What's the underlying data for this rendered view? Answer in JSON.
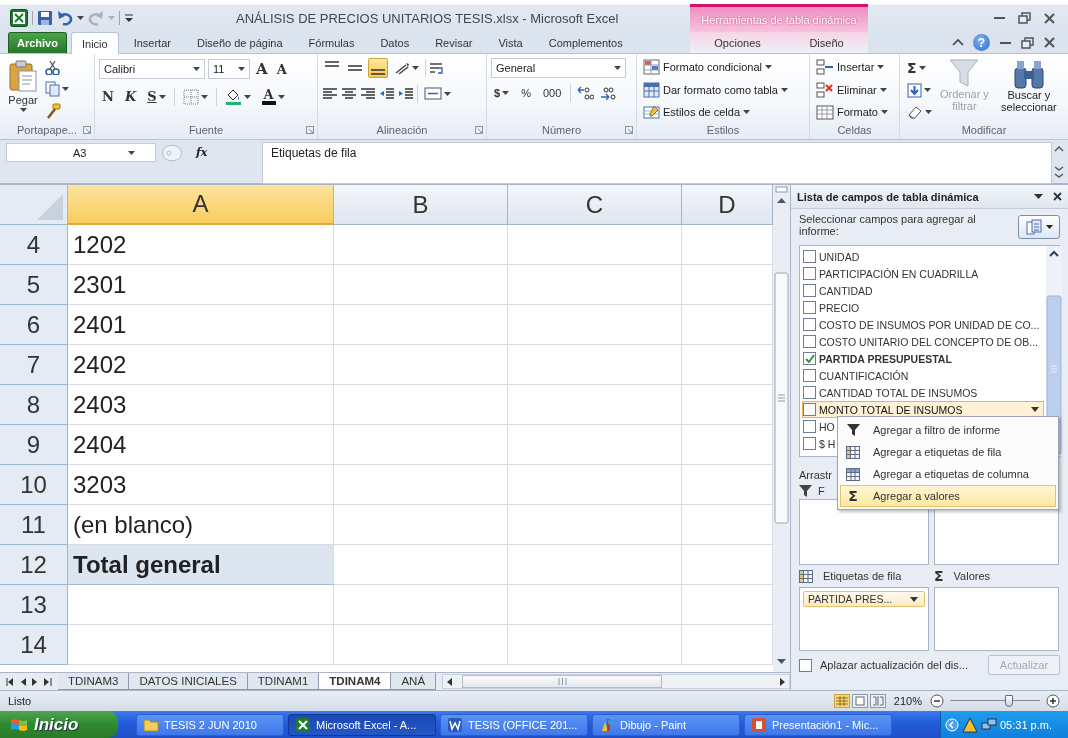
{
  "title_bar": {
    "title": "ANÁLISIS DE PRECIOS UNITARIOS TESIS.xlsx  -  Microsoft Excel",
    "context_title": "Herramientas de tabla dinámica"
  },
  "ribbon_tabs": [
    {
      "label": "Archivo",
      "kind": "file",
      "selected": false
    },
    {
      "label": "Inicio",
      "kind": "main",
      "selected": true
    },
    {
      "label": "Insertar",
      "kind": "main",
      "selected": false
    },
    {
      "label": "Diseño de página",
      "kind": "main",
      "selected": false
    },
    {
      "label": "Fórmulas",
      "kind": "main",
      "selected": false
    },
    {
      "label": "Datos",
      "kind": "main",
      "selected": false
    },
    {
      "label": "Revisar",
      "kind": "main",
      "selected": false
    },
    {
      "label": "Vista",
      "kind": "main",
      "selected": false
    },
    {
      "label": "Complementos",
      "kind": "main",
      "selected": false
    },
    {
      "label": "Opciones",
      "kind": "context",
      "selected": false
    },
    {
      "label": "Diseño",
      "kind": "context",
      "selected": false
    }
  ],
  "help": "?",
  "ribbon": {
    "clipboard": {
      "paste": "Pegar",
      "label": "Portapape..."
    },
    "font": {
      "name": "Calibri",
      "size": "11",
      "grow": "A",
      "shrink": "A",
      "bold": "N",
      "italic": "K",
      "underline": "S",
      "color_letter": "A",
      "label": "Fuente"
    },
    "alignment": {
      "vertical": [
        {
          "selected": false
        },
        {
          "selected": false
        },
        {
          "selected": true
        }
      ],
      "label": "Alineación"
    },
    "number": {
      "format": "General",
      "currency": "$",
      "percent": "%",
      "thousands": "000",
      "label": "Número"
    },
    "styles": {
      "items": [
        {
          "label": "Formato condicional",
          "kind": "conditional"
        },
        {
          "label": "Dar formato como tabla",
          "kind": "table"
        },
        {
          "label": "Estilos de celda",
          "kind": "cell"
        }
      ],
      "label": "Estilos"
    },
    "cells": {
      "items": [
        {
          "label": "Insertar",
          "kind": "insert"
        },
        {
          "label": "Eliminar",
          "kind": "delete"
        },
        {
          "label": "Formato",
          "kind": "format"
        }
      ],
      "label": "Celdas"
    },
    "editing": {
      "autosum": "Σ",
      "sort": {
        "label": "Ordenar y filtrar",
        "disabled": true
      },
      "find": {
        "label": "Buscar y seleccionar",
        "disabled": false
      },
      "label": "Modificar"
    }
  },
  "formula_bar": {
    "name_box": "A3",
    "fx": "fx",
    "formula": "Etiquetas de fila"
  },
  "sheet": {
    "columns": [
      {
        "label": "A",
        "selected": true
      },
      {
        "label": "B",
        "selected": false
      },
      {
        "label": "C",
        "selected": false
      },
      {
        "label": "D",
        "selected": false
      }
    ],
    "rows": [
      {
        "header": "4",
        "value": "1202",
        "kind": "item"
      },
      {
        "header": "5",
        "value": "2301",
        "kind": "item"
      },
      {
        "header": "6",
        "value": "2401",
        "kind": "item"
      },
      {
        "header": "7",
        "value": "2402",
        "kind": "item"
      },
      {
        "header": "8",
        "value": "2403",
        "kind": "item"
      },
      {
        "header": "9",
        "value": "2404",
        "kind": "item"
      },
      {
        "header": "10",
        "value": "3203",
        "kind": "item"
      },
      {
        "header": "11",
        "value": "(en blanco)",
        "kind": "item"
      },
      {
        "header": "12",
        "value": "Total general",
        "kind": "total"
      },
      {
        "header": "13",
        "kind": "empty"
      },
      {
        "header": "14",
        "kind": "empty"
      }
    ]
  },
  "pivot_pane": {
    "title": "Lista de campos de tabla dinámica",
    "prompt": "Seleccionar campos para agregar al informe:",
    "fields": [
      {
        "label": "UNIDAD",
        "checked": false,
        "selected": false
      },
      {
        "label": "PARTICIPACIÓN EN CUADRILLA",
        "checked": false,
        "selected": false
      },
      {
        "label": "CANTIDAD",
        "checked": false,
        "selected": false
      },
      {
        "label": "PRECIO",
        "checked": false,
        "selected": false
      },
      {
        "label": "COSTO DE INSUMOS POR UNIDAD DE CO...",
        "checked": false,
        "selected": false
      },
      {
        "label": "COSTO UNITARIO DEL CONCEPTO DE OB...",
        "checked": false,
        "selected": false
      },
      {
        "label": "PARTIDA PRESUPUESTAL",
        "checked": true,
        "selected": false
      },
      {
        "label": "CUANTIFICACIÓN",
        "checked": false,
        "selected": false
      },
      {
        "label": "CANTIDAD TOTAL DE INSUMOS",
        "checked": false,
        "selected": false
      },
      {
        "label": "MONTO TOTAL DE  INSUMOS",
        "checked": false,
        "selected": true
      },
      {
        "label": "HO",
        "checked": false,
        "selected": false
      },
      {
        "label": "$ H",
        "checked": false,
        "selected": false
      }
    ],
    "menu": [
      {
        "label": "Agregar a filtro de informe",
        "kind": "filter",
        "selected": false
      },
      {
        "label": "Agregar a etiquetas de fila",
        "kind": "rows",
        "selected": false
      },
      {
        "label": "Agregar a etiquetas de columna",
        "kind": "columns",
        "selected": false
      },
      {
        "label": "Agregar a valores",
        "kind": "values",
        "symbol": "Σ",
        "selected": true
      }
    ],
    "drag_hint": "Arrastr",
    "filter_area": {
      "label": "F"
    },
    "row_area": {
      "label": "Etiquetas de fila",
      "chips": [
        "PARTIDA PRES..."
      ]
    },
    "values_area": {
      "symbol": "Σ",
      "label": "Valores"
    },
    "defer": {
      "label": "Aplazar actualización del dis...",
      "checked": false
    },
    "update_button": {
      "label": "Actualizar",
      "disabled": true
    }
  },
  "sheet_tabs": [
    {
      "label": "TDINAM3",
      "selected": false
    },
    {
      "label": "DATOS INICIALES",
      "selected": false
    },
    {
      "label": "TDINAM1",
      "selected": false
    },
    {
      "label": "TDINAM4",
      "selected": true
    },
    {
      "label": "ANÁ",
      "selected": false
    }
  ],
  "status_bar": {
    "status": "Listo",
    "zoom": "210%",
    "zoom_slider": {
      "level": 0.66
    }
  },
  "taskbar": {
    "start": "Inicio",
    "items": [
      {
        "label": "TESIS 2 JUN 2010",
        "kind": "folder",
        "selected": false
      },
      {
        "label": "Microsoft Excel - A...",
        "kind": "excel",
        "selected": true
      },
      {
        "label": "TESIS (OFFICE 201...",
        "kind": "word",
        "selected": false
      },
      {
        "label": "Dibujo - Paint",
        "kind": "paint",
        "selected": false
      },
      {
        "label": "Presentación1 - Mic...",
        "kind": "powerpoint",
        "selected": false
      }
    ],
    "clock": "05:31 p.m."
  }
}
